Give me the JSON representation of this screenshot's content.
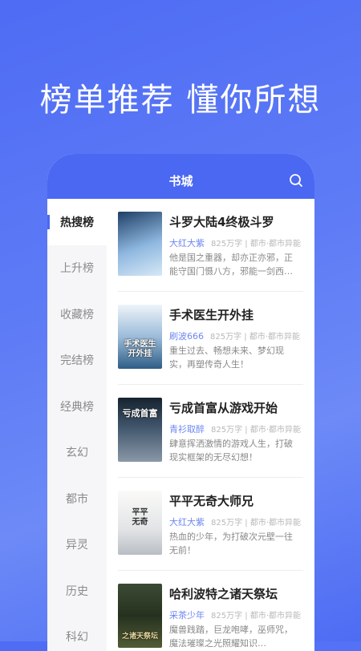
{
  "headline": "榜单推荐 懂你所想",
  "app": {
    "title": "书城"
  },
  "sidebar": {
    "items": [
      {
        "label": "热搜榜",
        "active": true
      },
      {
        "label": "上升榜"
      },
      {
        "label": "收藏榜"
      },
      {
        "label": "完结榜"
      },
      {
        "label": "经典榜"
      },
      {
        "label": "玄幻"
      },
      {
        "label": "都市"
      },
      {
        "label": "异灵"
      },
      {
        "label": "历史"
      },
      {
        "label": "科幻"
      }
    ]
  },
  "books": [
    {
      "title": "斗罗大陆4终极斗罗",
      "author": "大红大紫",
      "info": "825万字 | 都市·都市异能",
      "desc": "他是国之重器，却亦正亦邪，正能守国门慑八方，邪能一剑西…",
      "cover_colors": [
        "#3c6fa0",
        "#9fc4e6"
      ]
    },
    {
      "title": "手术医生开外挂",
      "author": "刷波666",
      "info": "825万字 | 都市·都市异能",
      "desc": "重生过去、畅想未来、梦幻现实，再塑传奇人生！",
      "cover_text": "手术医生\n开外挂",
      "cover_colors": [
        "#dbe7f2",
        "#3f6e99"
      ]
    },
    {
      "title": "亏成首富从游戏开始",
      "author": "青衫取醉",
      "info": "825万字 | 都市·都市异能",
      "desc": "肆意挥洒激情的游戏人生，打破现实框架的无尽幻想！",
      "cover_text": "亏成首富",
      "cover_colors": [
        "#1f2d3d",
        "#6a7a8e"
      ]
    },
    {
      "title": "平平无奇大师兄",
      "author": "大红大紫",
      "info": "825万字 | 都市·都市异能",
      "desc": "热血的少年，为打破次元壁一往无前！",
      "cover_text": "平平\n无奇",
      "cover_colors": [
        "#f2f2f0",
        "#c8ccd0"
      ]
    },
    {
      "title": "哈利波特之诸天祭坛",
      "author": "采茶少年",
      "info": "825万字 | 都市·都市异能",
      "desc": "魔兽践踏，巨龙咆哮，巫师咒，魔法璀璨之光照耀知识…",
      "cover_text": "之诸天祭坛",
      "cover_colors": [
        "#2b3a2a",
        "#6e7b4a"
      ]
    }
  ]
}
